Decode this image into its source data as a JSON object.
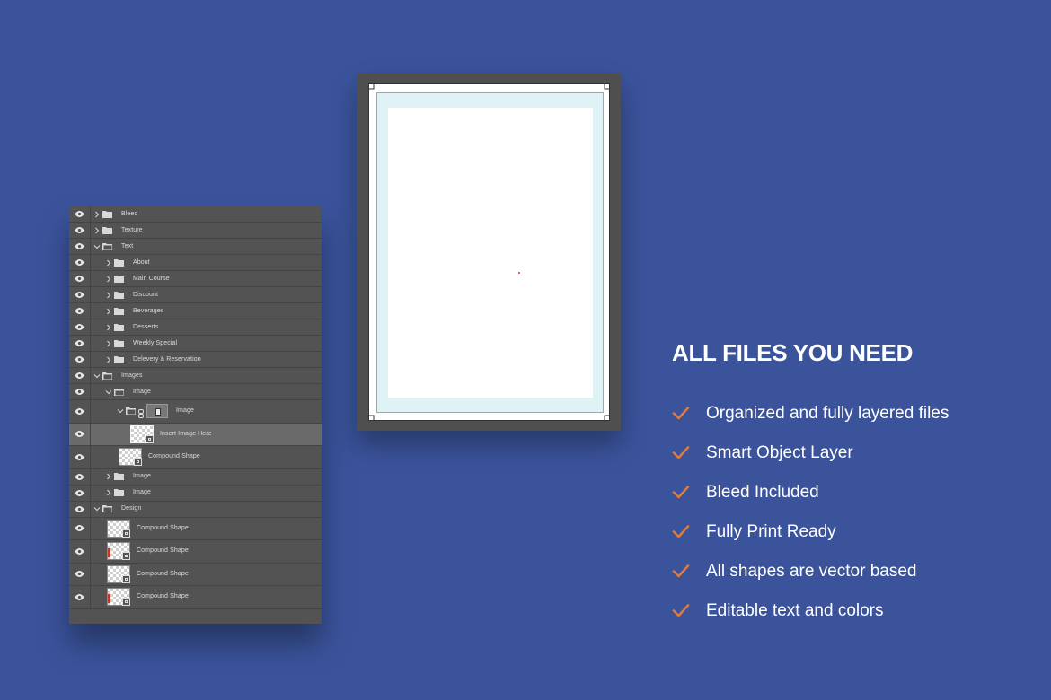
{
  "layers": [
    {
      "label": "Bleed",
      "type": "folder",
      "expanded": false,
      "indent": 0
    },
    {
      "label": "Texture",
      "type": "folder",
      "expanded": false,
      "indent": 0
    },
    {
      "label": "Text",
      "type": "folder",
      "expanded": true,
      "indent": 0
    },
    {
      "label": "About",
      "type": "folder",
      "expanded": false,
      "indent": 1
    },
    {
      "label": "Main Course",
      "type": "folder",
      "expanded": false,
      "indent": 1
    },
    {
      "label": "Discount",
      "type": "folder",
      "expanded": false,
      "indent": 1
    },
    {
      "label": "Beverages",
      "type": "folder",
      "expanded": false,
      "indent": 1
    },
    {
      "label": "Desserts",
      "type": "folder",
      "expanded": false,
      "indent": 1
    },
    {
      "label": "Weekly Special",
      "type": "folder",
      "expanded": false,
      "indent": 1
    },
    {
      "label": "Delevery & Reservation",
      "type": "folder",
      "expanded": false,
      "indent": 1
    },
    {
      "label": "Images",
      "type": "folder",
      "expanded": true,
      "indent": 0
    },
    {
      "label": "Image",
      "type": "folder",
      "expanded": true,
      "indent": 1
    },
    {
      "label": "Image",
      "type": "masked-folder",
      "expanded": true,
      "indent": 2
    },
    {
      "label": "Insert Image Here",
      "type": "smart-object",
      "indent": 3,
      "selected": true
    },
    {
      "label": "Compound Shape",
      "type": "shape",
      "indent": 2
    },
    {
      "label": "Image",
      "type": "folder",
      "expanded": false,
      "indent": 1
    },
    {
      "label": "Image",
      "type": "folder",
      "expanded": false,
      "indent": 1
    },
    {
      "label": "Design",
      "type": "folder",
      "expanded": true,
      "indent": 0
    },
    {
      "label": "Compound Shape",
      "type": "shape",
      "indent": 1
    },
    {
      "label": "Compound Shape",
      "type": "shape",
      "indent": 1,
      "accent": true
    },
    {
      "label": "Compound Shape",
      "type": "shape",
      "indent": 1
    },
    {
      "label": "Compound Shape",
      "type": "shape",
      "indent": 1,
      "accent": true
    }
  ],
  "features": {
    "title": "ALL FILES YOU NEED",
    "items": [
      "Organized and fully layered files",
      "Smart Object Layer",
      "Bleed Included",
      "Fully Print Ready",
      "All shapes are vector based",
      "Editable text and colors"
    ]
  },
  "colors": {
    "background": "#3a539b",
    "panel": "#535353",
    "check": "#e07b39",
    "text": "#ffffff"
  },
  "icons": {
    "visibility": "eye-icon",
    "group": "folder-icon",
    "toggle": "chevron-icon",
    "feature": "check-icon"
  }
}
